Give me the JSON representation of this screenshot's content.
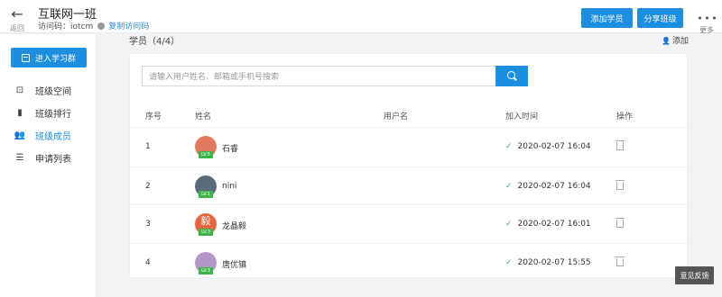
{
  "header": {
    "back_label": "返回",
    "title": "互联网一班",
    "access_code": "访问码：iotcm",
    "copy_link": "复制访问码",
    "add_student": "添加学员",
    "share_class": "分享班级",
    "more_label": "更多"
  },
  "sidebar": {
    "join_button": "进入学习群",
    "items": [
      {
        "label": "班级空间",
        "icon": "space-icon",
        "glyph": "⊡"
      },
      {
        "label": "班级排行",
        "icon": "ranking-icon",
        "glyph": "▮"
      },
      {
        "label": "班级成员",
        "icon": "members-icon",
        "glyph": "👥",
        "active": true
      },
      {
        "label": "申请列表",
        "icon": "list-icon",
        "glyph": "☰"
      }
    ]
  },
  "main": {
    "section_title": "学员（4/4）",
    "add_link": "添加",
    "search_placeholder": "请输入用户姓名、邮箱或手机号搜索",
    "columns": [
      "序号",
      "姓名",
      "用户名",
      "加入时间",
      "操作"
    ],
    "rows": [
      {
        "index": "1",
        "name": "石睿",
        "level": "LV.5",
        "username": "",
        "joined": "2020-02-07 16:04",
        "avatar_color": "#e07a5f",
        "avatar_char": ""
      },
      {
        "index": "2",
        "name": "nini",
        "level": "LV.1",
        "username": "",
        "joined": "2020-02-07 16:04",
        "avatar_color": "#5a6b7c",
        "avatar_char": ""
      },
      {
        "index": "3",
        "name": "龙晶毅",
        "level": "LV.3",
        "username": "",
        "joined": "2020-02-07 16:01",
        "avatar_color": "#e8643c",
        "avatar_char": "毅"
      },
      {
        "index": "4",
        "name": "唐优镇",
        "level": "LV.3",
        "username": "",
        "joined": "2020-02-07 15:55",
        "avatar_color": "#b497c8",
        "avatar_char": ""
      }
    ],
    "feedback": "意见反馈"
  },
  "colors": {
    "accent": "#1d8fe1",
    "level_badge": "#3bb54a",
    "check": "#4caf50"
  }
}
